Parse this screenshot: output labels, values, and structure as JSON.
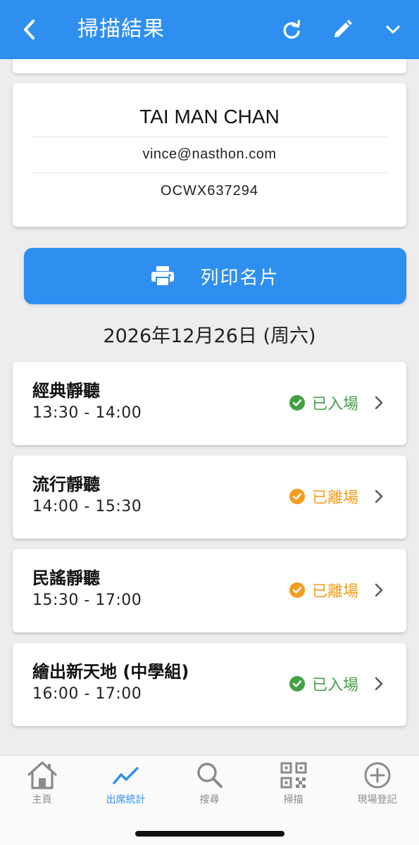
{
  "header": {
    "title": "掃描結果",
    "back_icon": "chevron-left-icon",
    "actions": [
      "refresh-icon",
      "edit-pencil-icon",
      "chevron-down-icon"
    ]
  },
  "profile": {
    "name": "TAI MAN CHAN",
    "email": "vince@nasthon.com",
    "code": "OCWX637294"
  },
  "print_button": {
    "label": "列印名片",
    "icon": "printer-icon"
  },
  "date": "2026年12月26日 (周六)",
  "sessions": [
    {
      "title": "經典靜聽",
      "time": "13:30 - 14:00",
      "status": "已入場",
      "status_color": "#43a047",
      "status_icon": "check-circle-icon"
    },
    {
      "title": "流行靜聽",
      "time": "14:00 - 15:30",
      "status": "已離場",
      "status_color": "#f39c1d",
      "status_icon": "check-circle-icon"
    },
    {
      "title": "民謠靜聽",
      "time": "15:30 - 17:00",
      "status": "已離場",
      "status_color": "#f39c1d",
      "status_icon": "check-circle-icon"
    },
    {
      "title": "繪出新天地 (中學組)",
      "time": "16:00 - 17:00",
      "status": "已入場",
      "status_color": "#43a047",
      "status_icon": "check-circle-icon"
    }
  ],
  "tabs": [
    {
      "label": "主頁",
      "icon": "home-icon",
      "active": false
    },
    {
      "label": "出席統計",
      "icon": "trend-chart-icon",
      "active": true
    },
    {
      "label": "搜尋",
      "icon": "search-icon",
      "active": false
    },
    {
      "label": "掃描",
      "icon": "qr-code-icon",
      "active": false
    },
    {
      "label": "現場登記",
      "icon": "plus-circle-icon",
      "active": false
    }
  ],
  "colors": {
    "primary": "#2e8ff0",
    "background": "#ededed",
    "checked_in": "#43a047",
    "checked_out": "#f39c1d"
  }
}
